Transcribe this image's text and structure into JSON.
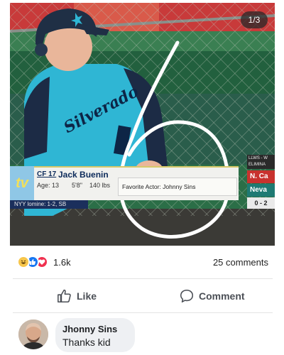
{
  "post": {
    "image": {
      "pager": "1/3",
      "lower_third": {
        "logo": "tv",
        "position": "CF 17",
        "player_name": "Jack Buenin",
        "age": "Age: 13",
        "height": "5'8\"",
        "weight": "140 lbs",
        "fun_fact": "Favorite Actor: Johnny Sins",
        "bottom_bar": "NYY  lomine: 1-2, SB"
      },
      "scoreboard": {
        "header_line1": "LLWS - W",
        "header_line2": "ELIMINA",
        "team1": "N. Ca",
        "team2": "Neva",
        "count": "0 - 2"
      },
      "jersey_text": "Silverado",
      "colors": {
        "jersey": "#2fb6d4",
        "circle_annotation": "#ffffff",
        "field": "#1f5a3a"
      }
    },
    "reactions": {
      "icons": [
        "haha-icon",
        "like-icon",
        "love-icon"
      ],
      "count": "1.6k"
    },
    "comments_count": "25 comments",
    "actions": {
      "like_label": "Like",
      "comment_label": "Comment"
    },
    "top_comment": {
      "author": "Jhonny Sins",
      "text": "Thanks kid"
    }
  }
}
